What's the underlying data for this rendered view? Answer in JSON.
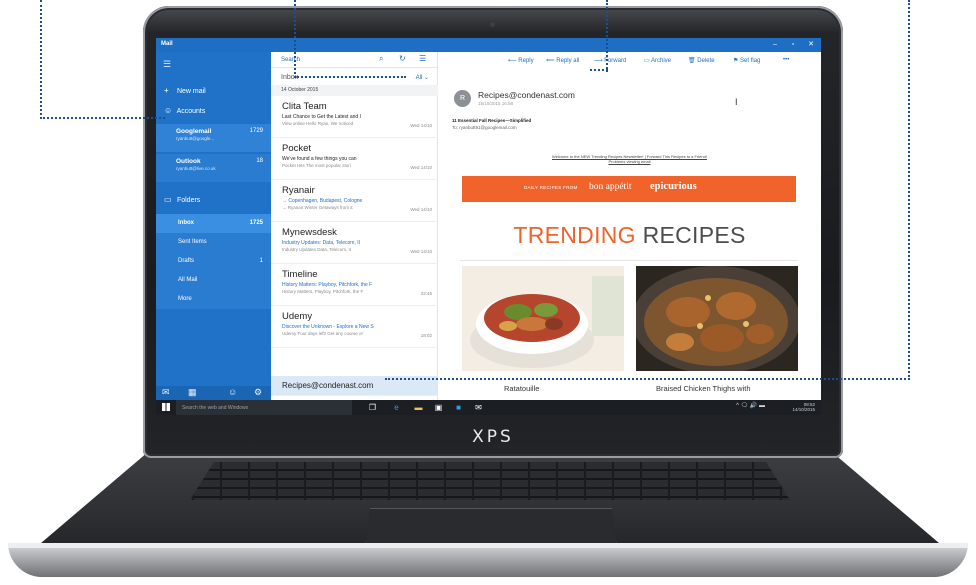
{
  "device": {
    "brand": "XPS"
  },
  "window": {
    "app_name": "Mail",
    "controls": {
      "minimize": "–",
      "maximize": "▫",
      "close": "✕"
    }
  },
  "nav": {
    "new_mail": "New mail",
    "accounts_label": "Accounts",
    "accounts": [
      {
        "name": "Googlemail",
        "address": "ryanbutt@google...",
        "count": "1729"
      },
      {
        "name": "Outlook",
        "address": "ryanbutt@live.co.uk",
        "count": "18"
      }
    ],
    "folders_label": "Folders",
    "folders": [
      {
        "name": "Inbox",
        "count": "1725"
      },
      {
        "name": "Sent Items",
        "count": ""
      },
      {
        "name": "Drafts",
        "count": "1"
      },
      {
        "name": "All Mail",
        "count": ""
      },
      {
        "name": "More",
        "count": ""
      }
    ]
  },
  "list": {
    "search_placeholder": "Search",
    "header": "Inbox",
    "filter": "All ⌄",
    "date_group": "14 October 2015",
    "messages": [
      {
        "from": "Clita Team",
        "subject": "Last Chance to Get the Latest and I",
        "preview": "View online Hello Ryan, We noticed",
        "time": "Wed 14/10"
      },
      {
        "from": "Pocket",
        "subject": "We've found a few things you can",
        "preview": "Pocket Hits The most popular stori",
        "time": "Wed 14/10"
      },
      {
        "from": "Ryanair",
        "subject": "→ Copenhagen, Budapest, Cologne",
        "preview": "→ Ryanair Winter Getaways from £",
        "time": "Wed 14/10"
      },
      {
        "from": "Mynewsdesk",
        "subject": "Industry Updates: Data, Telecom, II",
        "preview": "Industry Updates Data, Telecom, II",
        "time": "Wed 14/10"
      },
      {
        "from": "Timeline",
        "subject": "History Matters: Playboy, Pitchfork, the F",
        "preview": "History Matters, Playboy, Pitchfork, the F",
        "time": "22:45"
      },
      {
        "from": "Udemy",
        "subject": "Discover the Unknown - Explore a New S",
        "preview": "Udemy Four days left! Get any course or",
        "time": "18:02"
      }
    ],
    "peek": "Recipes@condenast.com"
  },
  "reader": {
    "commands": {
      "reply": "Reply",
      "reply_all": "Reply all",
      "forward": "Forward",
      "archive": "Archive",
      "delete": "Delete",
      "set_flag": "Set flag",
      "more": "•••"
    },
    "sender": "Recipes@condenast.com",
    "sender_initial": "R",
    "sent": "15/10/2015 16:58",
    "subject": "11 Essential Fall Recipes—Simplified",
    "to": "To: ryanbutt91@googlemail.com",
    "note_1": "Welcome to the NEW Trending Recipes Newsletter! | Forward This Recipes to a Friend!",
    "note_2": "Problems viewing email",
    "banner_small": "DAILY RECIPES FROM",
    "banner_brand_1": "bon appétit",
    "banner_brand_2": "epicurious",
    "headline_accent": "TRENDING",
    "headline_rest": " RECIPES",
    "captions": [
      "Ratatouille",
      "Braised Chicken Thighs with"
    ]
  },
  "taskbar": {
    "search_placeholder": "Search the web and Windows",
    "time": "08:52",
    "date": "14/10/2015",
    "tray_icons": "^ 🗨 🔊 ▬"
  },
  "colors": {
    "nav_blue": "#1f72c7",
    "accent_orange": "#f0632b",
    "callout": "#1b4f91"
  }
}
